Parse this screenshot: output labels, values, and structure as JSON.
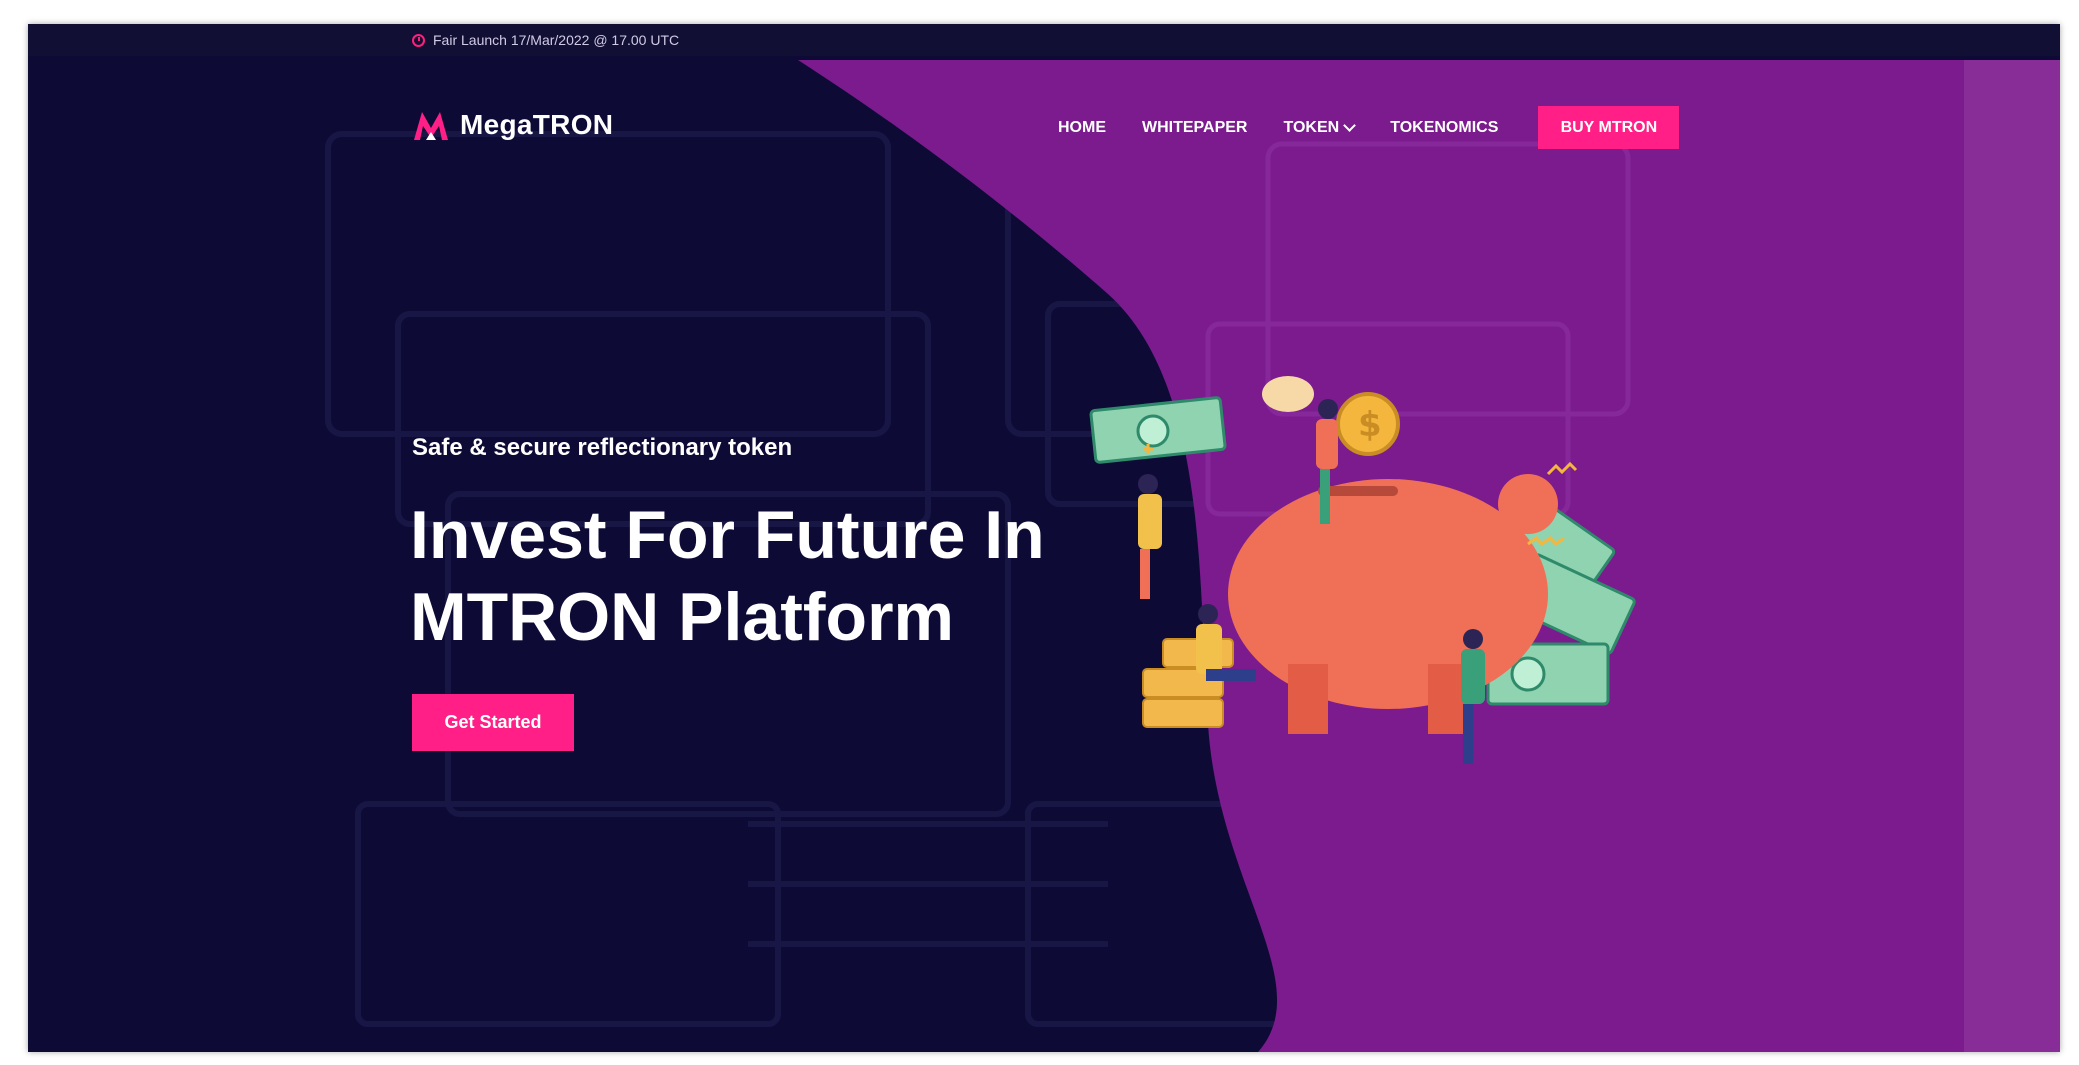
{
  "topbar": {
    "fair_launch": "Fair Launch 17/Mar/2022 @ 17.00 UTC"
  },
  "brand": {
    "name": "MegaTRON",
    "accent": "#ff1f86"
  },
  "nav": {
    "items": [
      "HOME",
      "WHITEPAPER",
      "TOKEN",
      "TOKENOMICS"
    ],
    "buy_label": "BUY MTRON"
  },
  "hero": {
    "tagline": "Safe & secure reflectionary token",
    "headline_line1": "Invest For Future In",
    "headline_line2": "MTRON Platform",
    "cta_label": "Get Started"
  },
  "colors": {
    "navy": "#0d0b36",
    "purple": "#7b1b8e",
    "pink": "#ff1f86"
  },
  "icons": [
    "clock-icon",
    "megatron-logo",
    "chevron-down-icon",
    "piggy-bank-illustration"
  ]
}
